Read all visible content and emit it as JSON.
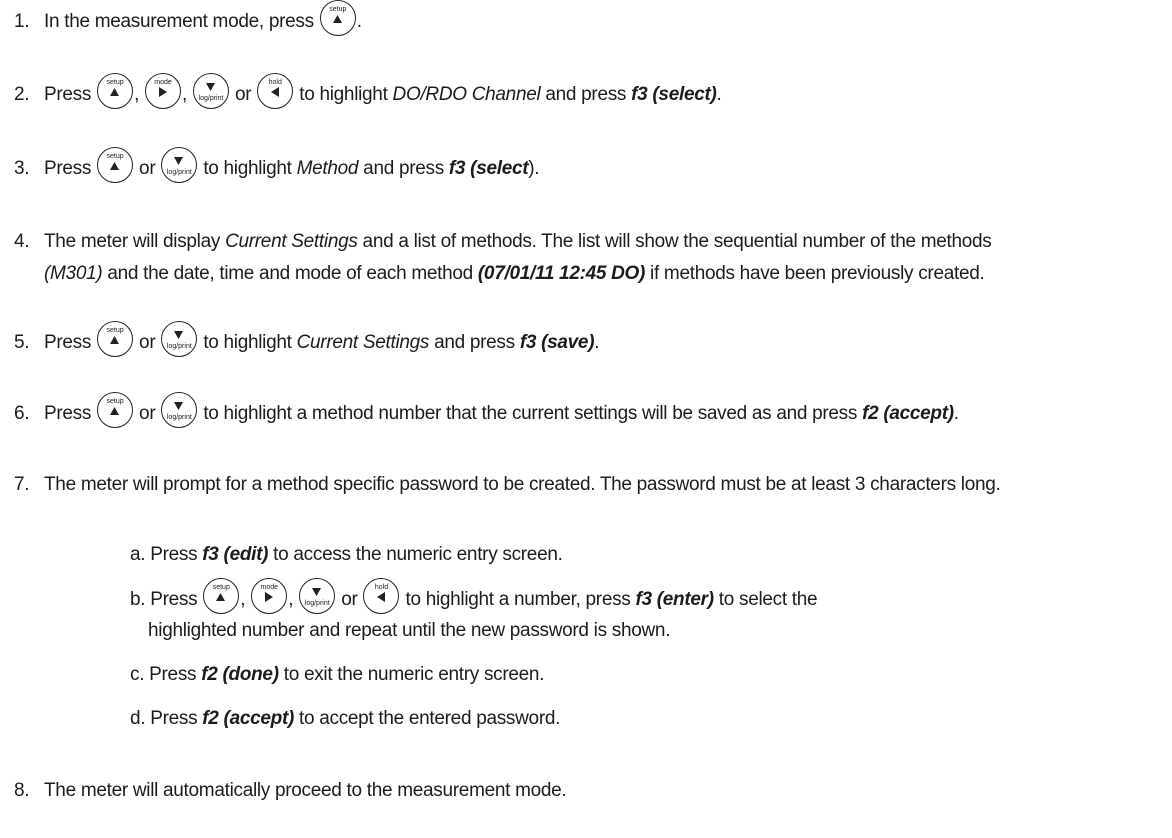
{
  "step1": {
    "num": "1.",
    "text": "In the measurement mode, press",
    "end": "."
  },
  "step2": {
    "num": "2.",
    "press": "Press",
    "comma": ",",
    "or": "or",
    "mid": "to highlight",
    "item": "DO/RDO Channel",
    "and": "and press",
    "fkey": "f3 (select)",
    "end": "."
  },
  "step3": {
    "num": "3.",
    "press": "Press",
    "or": "or",
    "mid": "to highlight",
    "item": "Method",
    "and": "and press",
    "fkey": "f3 (select",
    "end": ")."
  },
  "step4": {
    "num": "4.",
    "line1": "The meter will display",
    "item": "Current Settings",
    "line1b": "and a list of methods. The list will show the sequential number of the methods",
    "code1": "(M301)",
    "line2": "and the date, time and mode of each method",
    "code2": "(07/01/11  12:45  DO)",
    "line2b": "if methods have been previously created."
  },
  "step5": {
    "num": "5.",
    "press": "Press",
    "or": "or",
    "mid": "to highlight",
    "item": "Current Settings",
    "and": "and press",
    "fkey": "f3 (save)",
    "end": "."
  },
  "step6": {
    "num": "6.",
    "press": "Press",
    "or": "or",
    "mid": "to highlight a method number that the current settings will be saved as and press",
    "fkey": "f2 (accept)",
    "end": "."
  },
  "step7": {
    "num": "7.",
    "text": "The meter will prompt for a method specific password to be created. The password must be at least 3 characters long."
  },
  "sub_a": {
    "prefix": "a. Press",
    "fkey": "f3 (edit)",
    "text": "to access the numeric entry screen."
  },
  "sub_b": {
    "prefix": "b. Press",
    "comma": ",",
    "or": "or",
    "mid": "to highlight a number, press",
    "fkey": "f3 (enter)",
    "text": "to select the",
    "line2": "highlighted number and repeat until the new password is shown."
  },
  "sub_c": {
    "prefix": "c. Press",
    "fkey": "f2 (done)",
    "text": "to exit the numeric entry screen."
  },
  "sub_d": {
    "prefix": "d. Press",
    "fkey": "f2 (accept)",
    "text": "to accept the entered password."
  },
  "step8": {
    "num": "8.",
    "text": "The meter will automatically proceed to the measurement mode."
  },
  "keys": {
    "setup": "setup",
    "mode": "mode",
    "log_print": "log/print",
    "hold": "hold"
  },
  "icons": {
    "setup_key": "up-triangle",
    "mode_key": "right-triangle",
    "log_key": "down-triangle",
    "hold_key": "left-triangle"
  }
}
